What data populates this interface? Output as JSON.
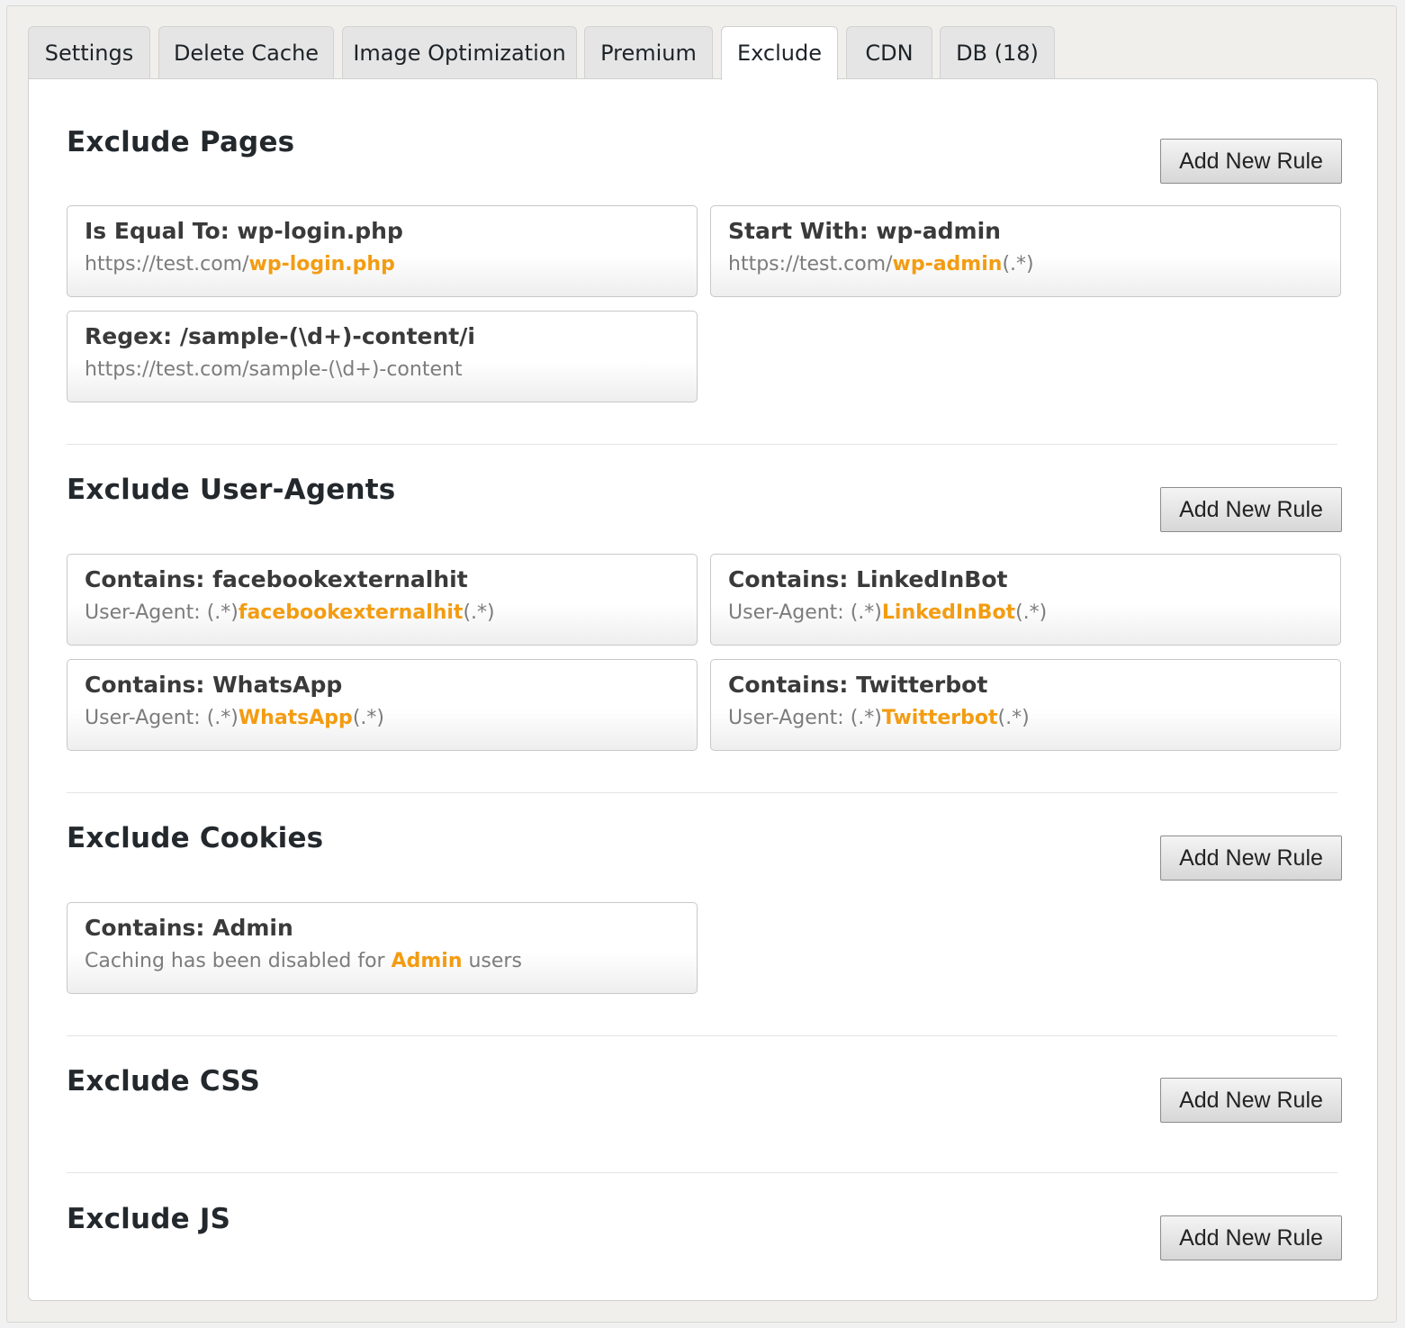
{
  "tabs": [
    {
      "label": "Settings",
      "active": false
    },
    {
      "label": "Delete Cache",
      "active": false
    },
    {
      "label": "Image Optimization",
      "active": false
    },
    {
      "label": "Premium",
      "active": false
    },
    {
      "label": "Exclude",
      "active": true
    },
    {
      "label": "CDN",
      "active": false
    },
    {
      "label": "DB (18)",
      "active": false
    }
  ],
  "highlight_color": "#f39c12",
  "add_button_label": "Add New Rule",
  "sections": [
    {
      "title": "Exclude Pages",
      "rules": [
        {
          "title": "Is Equal To: wp-login.php",
          "pre": "https://test.com/",
          "hl": "wp-login.php",
          "post": ""
        },
        {
          "title": "Start With: wp-admin",
          "pre": "https://test.com/",
          "hl": "wp-admin",
          "post": "(.*)"
        },
        {
          "title": "Regex: /sample-(\\d+)-content/i",
          "pre": "https://test.com/sample-(\\d+)-content",
          "hl": "",
          "post": ""
        }
      ]
    },
    {
      "title": "Exclude User-Agents",
      "rules": [
        {
          "title": "Contains: facebookexternalhit",
          "pre": "User-Agent: (.*)",
          "hl": "facebookexternalhit",
          "post": "(.*)"
        },
        {
          "title": "Contains: LinkedInBot",
          "pre": "User-Agent: (.*)",
          "hl": "LinkedInBot",
          "post": "(.*)"
        },
        {
          "title": "Contains: WhatsApp",
          "pre": "User-Agent: (.*)",
          "hl": "WhatsApp",
          "post": "(.*)"
        },
        {
          "title": "Contains: Twitterbot",
          "pre": "User-Agent: (.*)",
          "hl": "Twitterbot",
          "post": "(.*)"
        }
      ]
    },
    {
      "title": "Exclude Cookies",
      "rules": [
        {
          "title": "Contains: Admin",
          "pre": "Caching has been disabled for ",
          "hl": "Admin",
          "post": " users"
        }
      ]
    },
    {
      "title": "Exclude CSS",
      "rules": []
    },
    {
      "title": "Exclude JS",
      "rules": []
    }
  ]
}
